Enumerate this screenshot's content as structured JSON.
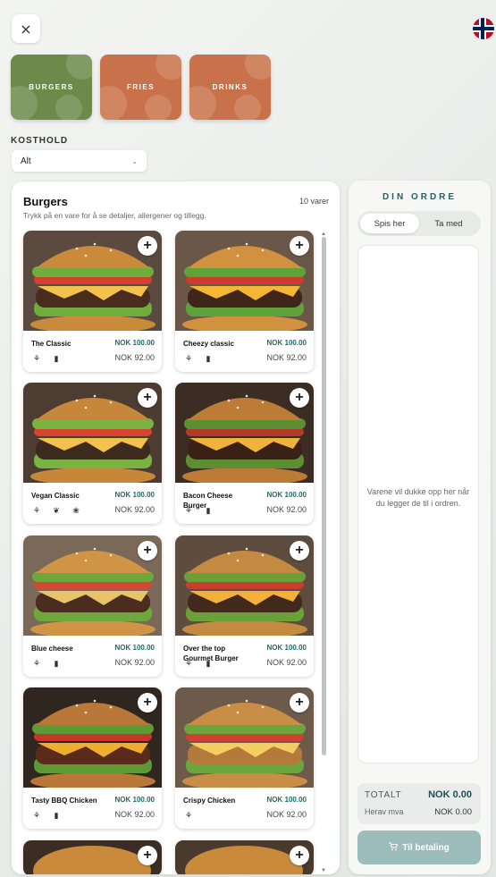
{
  "header": {
    "close_icon": "×"
  },
  "categories": [
    {
      "label": "BURGERS",
      "active": true
    },
    {
      "label": "FRIES",
      "active": false
    },
    {
      "label": "DRINKS",
      "active": false
    }
  ],
  "diet": {
    "label": "KOSTHOLD",
    "selected": "Alt"
  },
  "menu": {
    "title": "Burgers",
    "count": "10 varer",
    "subtitle": "Trykk på en vare for å se detaljer, allergener og tillegg.",
    "items": [
      {
        "name": "The Classic",
        "price": "NOK 100.00",
        "price2": "NOK 92.00",
        "allergens": [
          "wheat-icon",
          "milk-icon"
        ]
      },
      {
        "name": "Cheezy classic",
        "price": "NOK 100.00",
        "price2": "NOK 92.00",
        "allergens": [
          "wheat-icon",
          "milk-icon"
        ]
      },
      {
        "name": "Vegan Classic",
        "price": "NOK 100.00",
        "price2": "NOK 92.00",
        "allergens": [
          "wheat-icon",
          "leaf-icon",
          "nut-icon"
        ]
      },
      {
        "name": "Bacon Cheese Burger",
        "price": "NOK 100.00",
        "price2": "NOK 92.00",
        "allergens": [
          "wheat-icon",
          "milk-icon"
        ]
      },
      {
        "name": "Blue cheese",
        "price": "NOK 100.00",
        "price2": "NOK 92.00",
        "allergens": [
          "wheat-icon",
          "milk-icon"
        ]
      },
      {
        "name": "Over the top Gourmet Burger",
        "price": "NOK 100.00",
        "price2": "NOK 92.00",
        "allergens": [
          "wheat-icon",
          "milk-icon"
        ]
      },
      {
        "name": "Tasty BBQ Chicken",
        "price": "NOK 100.00",
        "price2": "NOK 92.00",
        "allergens": [
          "wheat-icon",
          "milk-icon"
        ]
      },
      {
        "name": "Crispy Chicken",
        "price": "NOK 100.00",
        "price2": "NOK 92.00",
        "allergens": [
          "wheat-icon"
        ]
      }
    ]
  },
  "order": {
    "title": "DIN ORDRE",
    "mode_options": [
      "Spis her",
      "Ta med"
    ],
    "mode_selected": "Spis her",
    "empty_text": "Varene vil dukke opp her når du legger de til i ordren.",
    "total_label": "TOTALT",
    "total_value": "NOK 0.00",
    "vat_label": "Herav mva",
    "vat_value": "NOK 0.00",
    "pay_button": "Til betaling"
  },
  "colors": {
    "accent": "#2a5f61",
    "category_active": "#6e8a4a",
    "category_inactive": "#c9714a",
    "pay_button": "#9dbcbc"
  }
}
